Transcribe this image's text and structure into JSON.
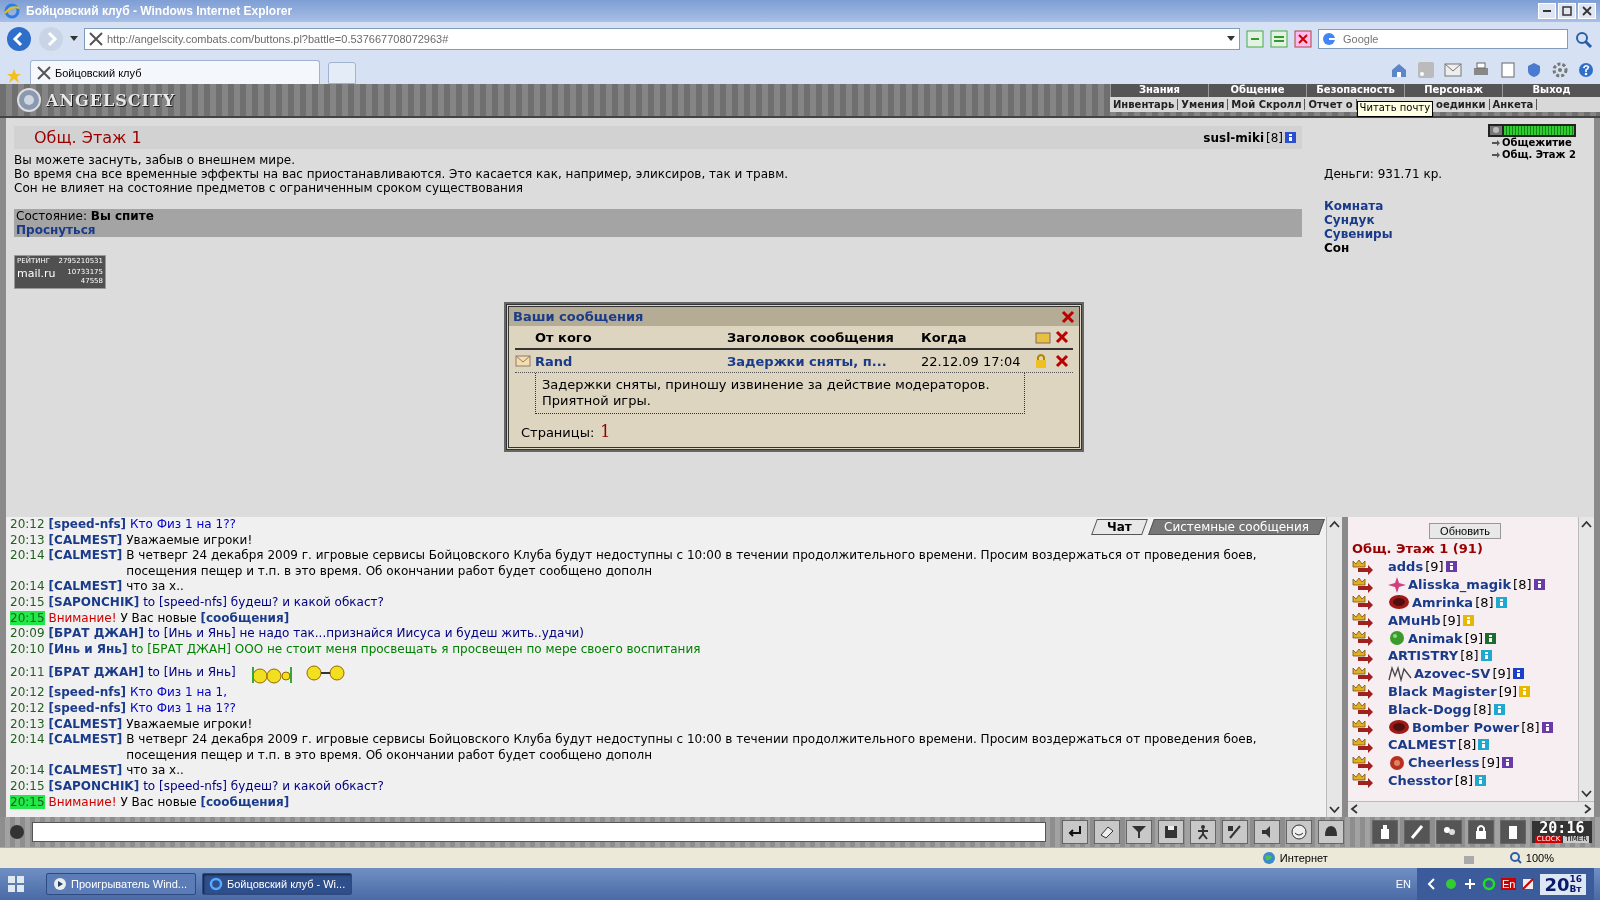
{
  "window": {
    "title": "Бойцовский клуб - Windows Internet Explorer"
  },
  "address_bar": {
    "url": "http://angelscity.combats.com/buttons.pl?battle=0.537667708072963#"
  },
  "search": {
    "placeholder": "Google"
  },
  "tabs": [
    {
      "label": "Бойцовский клуб",
      "selected": true
    }
  ],
  "game_header": {
    "logo": "ANGELSCITY",
    "menu": [
      "Знания",
      "Общение",
      "Безопасность",
      "Персонаж",
      "Выход"
    ],
    "submenu_left": [
      "Инвентарь",
      "Умения",
      "Мой Скролл",
      "Отчет о"
    ],
    "tooltip": "Читать почту",
    "submenu_right": [
      "оединки",
      "Анкета"
    ]
  },
  "room": {
    "title": "Общ. Этаж 1",
    "user": "susl-miki",
    "rank": "[8]",
    "description": [
      "Вы можете заснуть, забыв о внешнем мире.",
      "Во время сна все временные эффекты на вас приостанавливаются. Это касается как, например, эликсиров, так и травм.",
      "Сон не влияет на состояние предметов с ограниченным сроком существования"
    ],
    "state_label": "Состояние:",
    "state_value": "Вы спите",
    "wake_link": "Проснуться",
    "counter": {
      "label": "РЕЙТИНГ",
      "brand": "mail.ru",
      "numbers": [
        "2795210531",
        "10733175",
        "47558"
      ]
    }
  },
  "side": {
    "health": {
      "level": 1
    },
    "locations": [
      "Общежитие",
      "Общ. Этаж 2"
    ],
    "money": "Деньги: 931.71 кр.",
    "rooms": [
      {
        "label": "Комната",
        "selected": false
      },
      {
        "label": "Сундук",
        "selected": false
      },
      {
        "label": "Сувениры",
        "selected": false
      },
      {
        "label": "Сон",
        "selected": true
      }
    ]
  },
  "dialog": {
    "title": "Ваши сообщения",
    "columns": [
      "От кого",
      "Заголовок сообщения",
      "Когда"
    ],
    "messages": [
      {
        "from": "Rand",
        "subject": "Задержки сняты, п...",
        "date": "22.12.09 17:04",
        "expanded": true,
        "body": [
          "Задержки сняты, приношу извинение за действие модераторов.",
          "Приятной игры."
        ]
      }
    ],
    "pages_label": "Страницы:",
    "pages": [
      "1"
    ]
  },
  "chat": {
    "tabs": [
      {
        "label": "Чат",
        "selected": true
      },
      {
        "label": "Системные сообщения",
        "selected": false
      }
    ],
    "lines": [
      {
        "kind": "message",
        "time": "20:12",
        "author": "[speed-nfs]",
        "text": "Кто Физ 1 на 1??",
        "color": "#0000cc"
      },
      {
        "kind": "message",
        "time": "20:13",
        "author": "[CALMEST]",
        "text": "Уважаемые игроки!",
        "color": "#000000"
      },
      {
        "kind": "message",
        "time": "20:14",
        "author": "[CALMEST]",
        "text": "В четверг 24 декабря 2009 г. игровые сервисы Бойцовского Клуба будут недоступны с 10:00 в течении продолжительного времени. Просим воздержаться от проведения боев, посещения пещер и т.п. в это время. Об окончании работ будет сообщено дополн",
        "color": "#000000"
      },
      {
        "kind": "message",
        "time": "20:14",
        "author": "[CALMEST]",
        "text": "что за х..",
        "color": "#000000"
      },
      {
        "kind": "message",
        "time": "20:15",
        "author": "[SAPONCHIK]",
        "text": "to [speed-nfs] будеш? и какой обкаст?",
        "color": "#000080"
      },
      {
        "kind": "system",
        "time": "20:15",
        "alert": "Внимание!",
        "text": "У Вас новые",
        "link": "[сообщения]"
      },
      {
        "kind": "message",
        "time": "20:09",
        "author": "[БРАТ ДЖАН]",
        "text": "to [Инь и Янь] не надо так...признайся Иисуса и будеш жить..удачи)",
        "color": "#000080"
      },
      {
        "kind": "message",
        "time": "20:10",
        "author": "[Инь и Янь]",
        "text": "to [БРАТ ДЖАН] ООО не стоит меня просвещать я просвещен по мере своего воспитания",
        "color": "#008000"
      },
      {
        "kind": "emote",
        "time": "20:11",
        "author": "[БРАТ ДЖАН]",
        "text": "to [Инь и Янь]",
        "color": "#000080"
      },
      {
        "kind": "message",
        "time": "20:12",
        "author": "[speed-nfs]",
        "text": "Кто Физ 1 на 1,",
        "color": "#0000cc"
      },
      {
        "kind": "message",
        "time": "20:12",
        "author": "[speed-nfs]",
        "text": "Кто Физ 1 на 1??",
        "color": "#0000cc"
      },
      {
        "kind": "message",
        "time": "20:13",
        "author": "[CALMEST]",
        "text": "Уважаемые игроки!",
        "color": "#000000"
      },
      {
        "kind": "message",
        "time": "20:14",
        "author": "[CALMEST]",
        "text": "В четверг 24 декабря 2009 г. игровые сервисы Бойцовского Клуба будут недоступны с 10:00 в течении продолжительного времени. Просим воздержаться от проведения боев, посещения пещер и т.п. в это время. Об окончании работ будет сообщено дополн",
        "color": "#000000"
      },
      {
        "kind": "message",
        "time": "20:14",
        "author": "[CALMEST]",
        "text": "что за х..",
        "color": "#000000"
      },
      {
        "kind": "message",
        "time": "20:15",
        "author": "[SAPONCHIK]",
        "text": "to [speed-nfs] будеш? и какой обкаст?",
        "color": "#000080"
      },
      {
        "kind": "system",
        "time": "20:15",
        "alert": "Внимание!",
        "text": "У Вас новые",
        "link": "[сообщения]"
      }
    ]
  },
  "players": {
    "refresh": "Обновить",
    "room": "Общ. Этаж 1 (91)",
    "items": [
      {
        "kind": "plain",
        "name": "adds",
        "rank": "[9]",
        "color": "#6a3aa8"
      },
      {
        "kind": "star",
        "name": "Alisska_magik",
        "rank": "[8]",
        "color": "#6a3aa8"
      },
      {
        "kind": "emblem",
        "name": "Amrinka",
        "rank": "[8]",
        "color": "#1fa8d0"
      },
      {
        "kind": "plain",
        "name": "AMuHb",
        "rank": "[9]",
        "color": "#e8b800"
      },
      {
        "kind": "orb",
        "name": "Animak",
        "rank": "[9]",
        "color": "#1d6e2e"
      },
      {
        "kind": "plain",
        "name": "ARTISTRY",
        "rank": "[8]",
        "color": "#1fa8d0"
      },
      {
        "kind": "scribble",
        "name": "Azovec-SV",
        "rank": "[9]",
        "color": "#1a3fc8"
      },
      {
        "kind": "plain",
        "name": "Black Magister",
        "rank": "[9]",
        "color": "#e8b800"
      },
      {
        "kind": "plain",
        "name": "Black-Dogg",
        "rank": "[8]",
        "color": "#1fa8d0"
      },
      {
        "kind": "emblem",
        "name": "Bomber Power",
        "rank": "[8]",
        "color": "#6a3aa8"
      },
      {
        "kind": "plain",
        "name": "CALMEST",
        "rank": "[8]",
        "color": "#1fa8d0"
      },
      {
        "kind": "ball",
        "name": "Cheerless",
        "rank": "[9]",
        "color": "#6a3aa8"
      },
      {
        "kind": "plain",
        "name": "Chesstor",
        "rank": "[8]",
        "color": "#1fa8d0"
      }
    ]
  },
  "clock": {
    "time": "20:16",
    "labels": [
      "CLOCK",
      "TIMER"
    ]
  },
  "status_bar": {
    "zone": "Интернет",
    "zoom": "100%"
  },
  "taskbar": {
    "items": [
      {
        "label": "Проигрыватель Wind...",
        "selected": false
      },
      {
        "label": "Бойцовский клуб - Wi...",
        "selected": true
      }
    ],
    "lang": "EN",
    "tray_lang": "En",
    "clock": [
      "20",
      "16",
      "Вт"
    ]
  }
}
